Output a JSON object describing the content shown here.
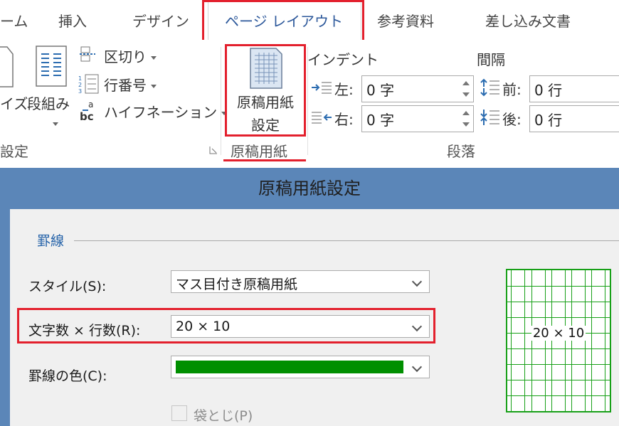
{
  "ribbon_tabs": {
    "home": "ーム",
    "insert": "挿入",
    "design": "デザイン",
    "page_layout": "ページ レイアウト",
    "references": "参考資料",
    "mailings": "差し込み文書"
  },
  "page_setup": {
    "size_label": "イズ",
    "columns_label": "段組み",
    "breaks_label": "区切り",
    "line_numbers_label": "行番号",
    "hyphenation_label": "ハイフネーション",
    "group_label": "設定"
  },
  "genko_group": {
    "button_line1": "原稿用紙",
    "button_line2": "設定",
    "group_label": "原稿用紙"
  },
  "paragraph": {
    "indent_heading": "インデント",
    "spacing_heading": "間隔",
    "left_label": "左:",
    "left_value": "0 字",
    "right_label": "右:",
    "right_value": "0 字",
    "before_label": "前:",
    "before_value": "0 行",
    "after_label": "後:",
    "after_value": "0 行",
    "group_label": "段落"
  },
  "dialog": {
    "title": "原稿用紙設定",
    "section_label": "罫線",
    "style_label": "スタイル(S):",
    "style_value": "マス目付き原稿用紙",
    "grid_label": "文字数 × 行数(R):",
    "grid_value": "20 × 10",
    "color_label": "罫線の色(C):",
    "color_value": "#008f00",
    "fold_label": "袋とじ(P)",
    "preview_text": "20 × 10"
  },
  "colors": {
    "accent": "#2b579a",
    "highlight": "#e3202d",
    "dialog_title_bg": "#5b86b8",
    "grid_green": "#18a018"
  }
}
